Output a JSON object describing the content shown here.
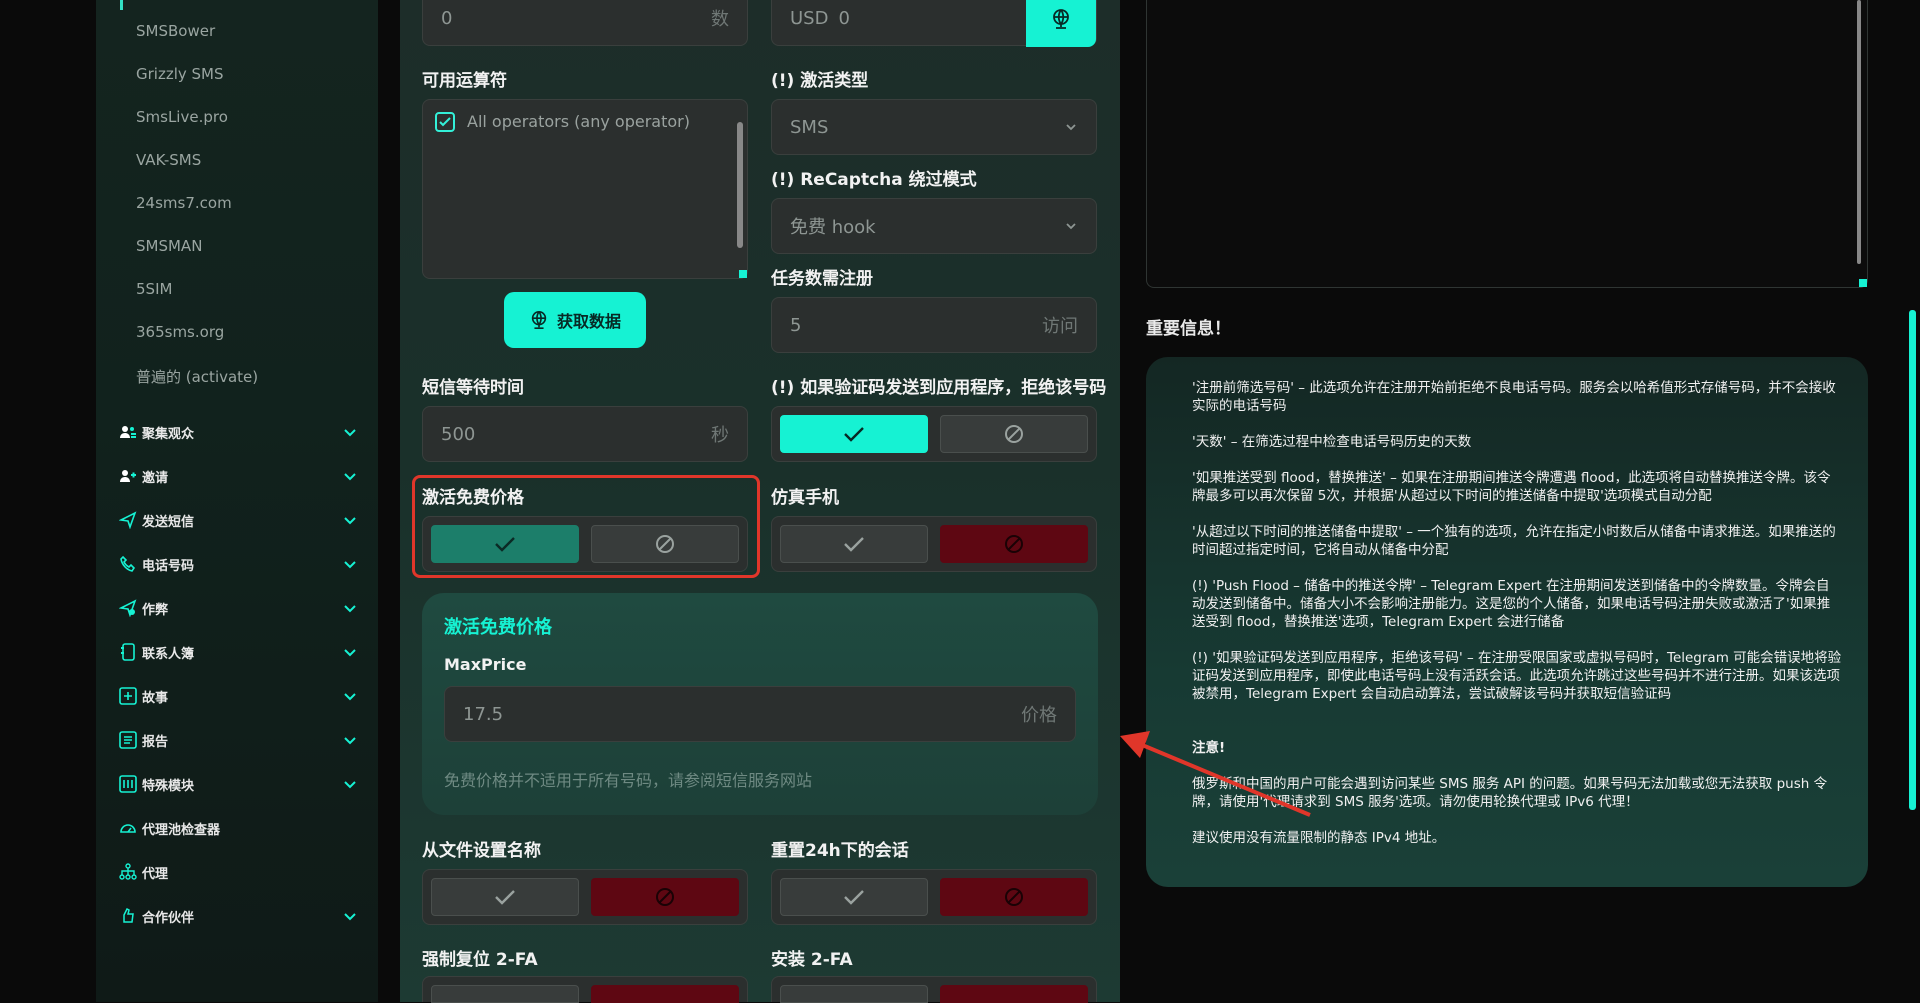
{
  "sidebar": {
    "sub_items": [
      "SMSBower",
      "Grizzly SMS",
      "SmsLive.pro",
      "VAK-SMS",
      "24sms7.com",
      "SMSMAN",
      "5SIM",
      "365sms.org",
      "普遍的 (activate)"
    ],
    "items": [
      {
        "label": "聚集观众",
        "icon": "audience-icon"
      },
      {
        "label": "邀请",
        "icon": "invite-icon"
      },
      {
        "label": "发送短信",
        "icon": "send-message-icon"
      },
      {
        "label": "电话号码",
        "icon": "phone-icon"
      },
      {
        "label": "作弊",
        "icon": "cheat-icon"
      },
      {
        "label": "联系人簿",
        "icon": "contacts-book-icon"
      },
      {
        "label": "故事",
        "icon": "story-icon"
      },
      {
        "label": "报告",
        "icon": "report-icon"
      },
      {
        "label": "特殊模块",
        "icon": "special-module-icon"
      },
      {
        "label": "代理池检查器",
        "icon": "proxy-checker-icon"
      },
      {
        "label": "代理",
        "icon": "proxy-icon"
      },
      {
        "label": "合作伙伴",
        "icon": "partner-icon"
      }
    ]
  },
  "form": {
    "top_left_value": "0",
    "top_left_suffix": "数",
    "top_right_prefix": "USD",
    "top_right_value": "0",
    "operators_label": "可用运算符",
    "operators_option": "All operators (any operator)",
    "fetch_button": "获取数据",
    "activation_type_label": "(!) 激活类型",
    "activation_type_value": "SMS",
    "recaptcha_label": "(!) ReCaptcha 绕过模式",
    "recaptcha_value": "免费 hook",
    "tasks_label": "任务数需注册",
    "tasks_value": "5",
    "tasks_suffix": "访问",
    "sms_wait_label": "短信等待时间",
    "sms_wait_value": "500",
    "sms_wait_suffix": "秒",
    "reject_label": "(!) 如果验证码发送到应用程序，拒绝该号码",
    "free_price_label": "激活免费价格",
    "emulate_label": "仿真手机",
    "free_box_title": "激活免费价格",
    "maxprice_label": "MaxPrice",
    "maxprice_value": "17.5",
    "maxprice_suffix": "价格",
    "free_box_note": "免费价格并不适用于所有号码，请参阅短信服务网站",
    "name_from_file_label": "从文件设置名称",
    "reset_sessions_label": "重置24h下的会话",
    "force_2fa_label": "强制复位 2-FA",
    "install_2fa_label": "安装 2-FA"
  },
  "info": {
    "title": "重要信息！",
    "paragraphs": [
      "'注册前筛选号码' – 此选项允许在注册开始前拒绝不良电话号码。服务会以哈希值形式存储号码，并不会接收实际的电话号码",
      "'天数' – 在筛选过程中检查电话号码历史的天数",
      "'如果推送受到 flood，替换推送' – 如果在注册期间推送令牌遭遇 flood，此选项将自动替换推送令牌。该令牌最多可以再次保留 5次，并根据'从超过以下时间的推送储备中提取'选项模式自动分配",
      "'从超过以下时间的推送储备中提取' – 一个独有的选项，允许在指定小时数后从储备中请求推送。如果推送的时间超过指定时间，它将自动从储备中分配",
      "(!) 'Push Flood – 储备中的推送令牌' – Telegram Expert 在注册期间发送到储备中的令牌数量。令牌会自动发送到储备中。储备大小不会影响注册能力。这是您的个人储备，如果电话号码注册失败或激活了'如果推送受到 flood，替换推送'选项，Telegram Expert 会进行储备",
      "(!) '如果验证码发送到应用程序，拒绝该号码' – 在注册受限国家或虚拟号码时，Telegram 可能会错误地将验证码发送到应用程序，即使此电话号码上没有活跃会话。此选项允许跳过这些号码并不进行注册。如果该选项被禁用，Telegram Expert 会自动启动算法，尝试破解该号码并获取短信验证码",
      "注意!",
      "俄罗斯和中国的用户可能会遇到访问某些 SMS 服务 API 的问题。如果号码无法加载或您无法获取 push 令牌，请使用'代理请求到 SMS 服务'选项。请勿使用轮换代理或 IPv6 代理！",
      "建议使用没有流量限制的静态 IPv4 地址。"
    ]
  },
  "colors": {
    "accent": "#16f2d3",
    "green_on": "#1c7e6a",
    "red_off": "#5e0712",
    "highlight": "#e0362a"
  }
}
